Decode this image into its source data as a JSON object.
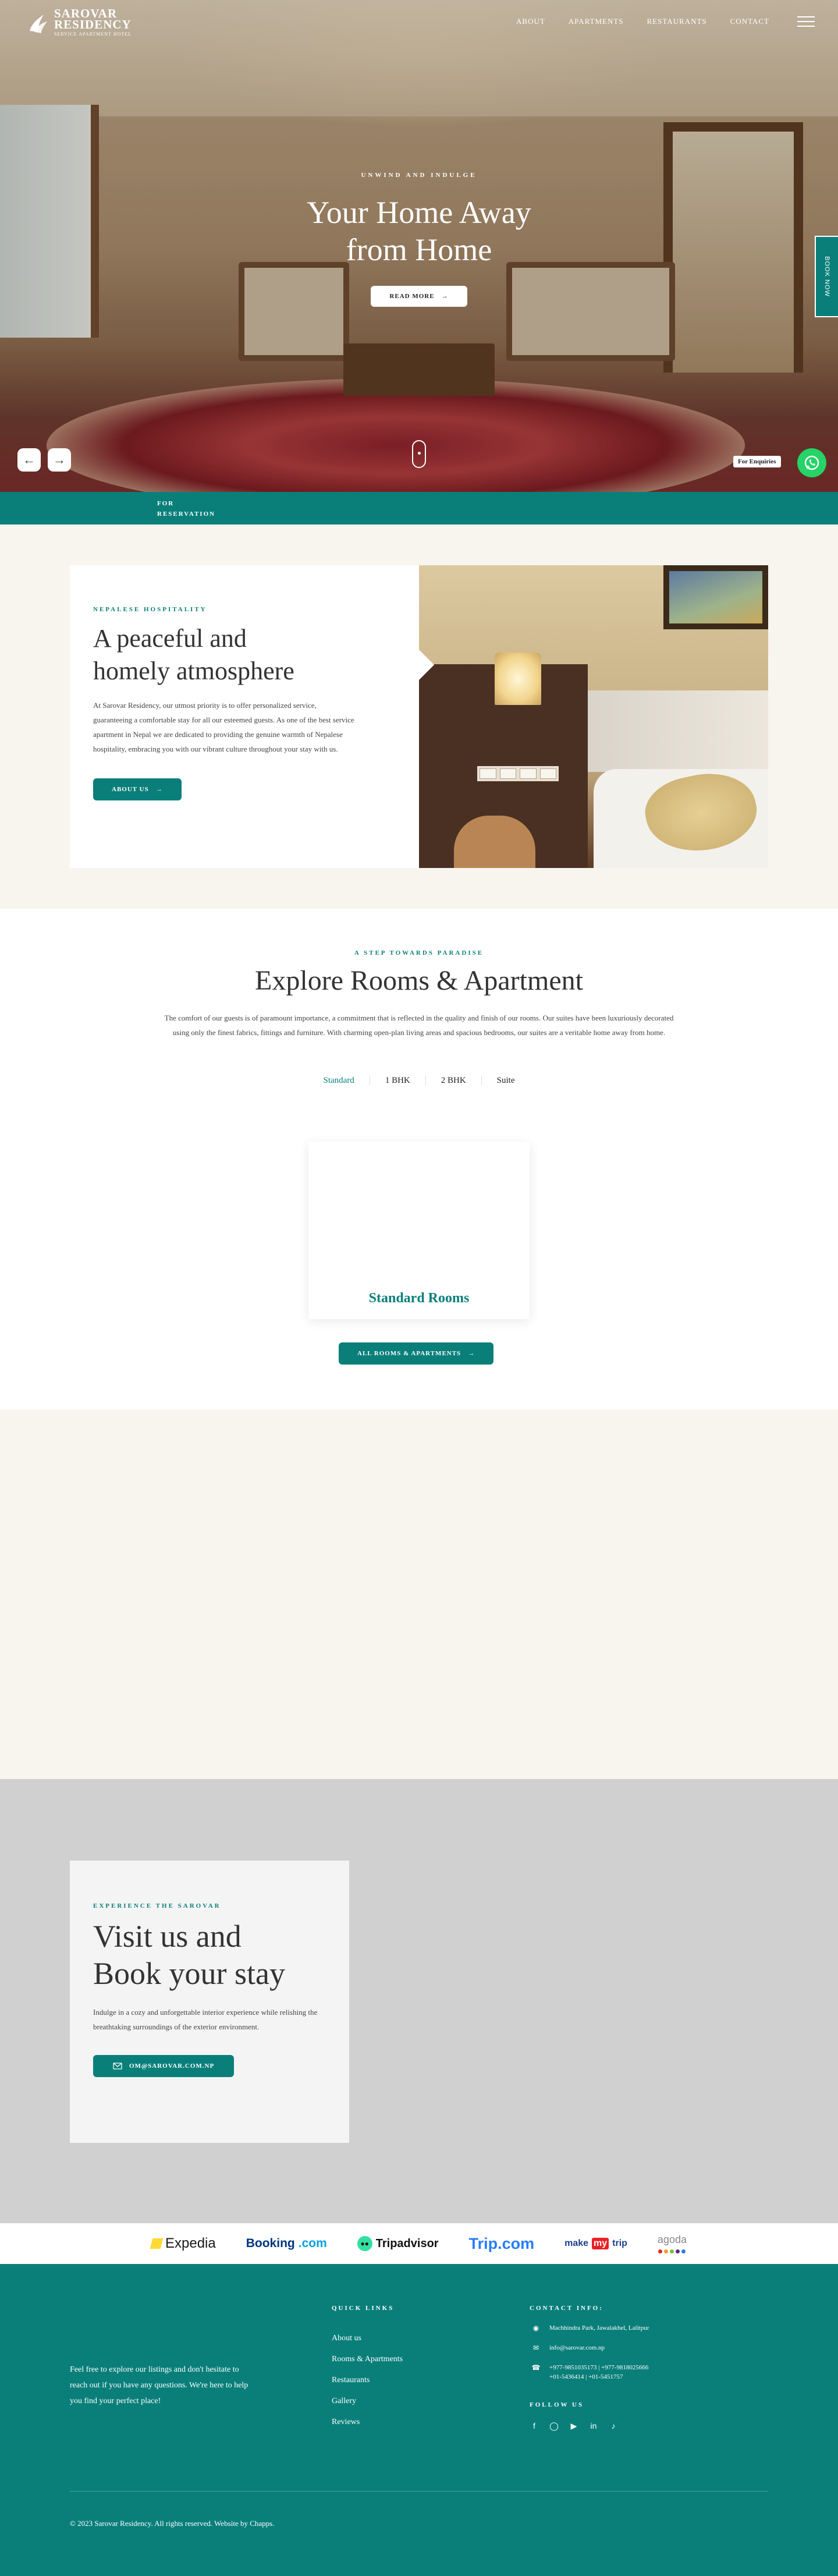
{
  "brand": {
    "name": "SAROVAR RESIDENCY",
    "name_line1": "SAROVAR",
    "name_line2": "RESIDENCY",
    "tagline": "SERVICE APARTMENT HOTEL"
  },
  "nav": {
    "items": [
      "ABOUT",
      "APARTMENTS",
      "RESTAURANTS",
      "CONTACT"
    ]
  },
  "hero": {
    "kicker": "UNWIND AND INDULGE",
    "title_line1": "Your Home Away",
    "title_line2": "from Home",
    "button_label": "READ MORE",
    "book_now": "BOOK NOW",
    "enquiries": "For Enquiries"
  },
  "reservation": {
    "label_line1": "FOR",
    "label_line2": "RESERVATION"
  },
  "about": {
    "kicker": "NEPALESE HOSPITALITY",
    "title_line1": "A peaceful and",
    "title_line2": "homely atmosphere",
    "body": "At Sarovar Residency, our utmost priority is to offer personalized service, guaranteeing a comfortable stay for all our esteemed guests. As one of the best service apartment in Nepal we are dedicated to providing the genuine warmth of Nepalese hospitality, embracing you with our vibrant culture throughout your stay with us.",
    "button_label": "ABOUT US"
  },
  "rooms": {
    "kicker": "A STEP TOWARDS PARADISE",
    "title": "Explore Rooms & Apartment",
    "body": "The comfort of our guests is of paramount importance, a commitment that is reflected in the quality and finish of our rooms. Our suites have been luxuriously decorated using only the finest fabrics, fittings and furniture. With charming open-plan living areas and spacious bedrooms, our suites are a veritable home away from home.",
    "tabs": [
      "Standard",
      "1 BHK",
      "2 BHK",
      "Suite"
    ],
    "active_tab": "Standard",
    "card_title": "Standard Rooms",
    "button_label": "ALL ROOMS & APARTMENTS"
  },
  "visit": {
    "kicker": "EXPERIENCE THE SAROVAR",
    "title_line1": "Visit us and",
    "title_line2": "Book your stay",
    "body": "Indulge in a cozy and unforgettable interior experience while relishing the breathtaking surroundings of the exterior environment.",
    "button_label": "OM@SAROVAR.COM.NP"
  },
  "partners": {
    "expedia": "Expedia",
    "booking_a": "Booking",
    "booking_b": ".com",
    "tripadvisor": "Tripadvisor",
    "tripcom": "Trip.com",
    "mmt_a": "make",
    "mmt_b": "my",
    "mmt_c": "trip",
    "agoda": "agoda"
  },
  "footer": {
    "tagline": "Feel free to explore our listings and don't hesitate to reach out if you have any questions. We're here to help you find your perfect place!",
    "quick_links_heading": "QUICK LINKS",
    "quick_links": [
      "About us",
      "Rooms & Apartments",
      "Restaurants",
      "Gallery",
      "Reviews"
    ],
    "contact_heading": "CONTACT INFO:",
    "address": "Machhindra Park, Jawalakhel, Lalitpur",
    "email": "info@sarovar.com.np",
    "phone_line1": "+977-9851035173 | +977-9818025666",
    "phone_line2": "+01-5436414 | +01-5451757",
    "follow_heading": "FOLLOW US",
    "copyright": "© 2023 Sarovar Residency. All rights reserved. Website by Chapps."
  },
  "colors": {
    "accent": "#0a7f7a",
    "whatsapp": "#25d366"
  }
}
